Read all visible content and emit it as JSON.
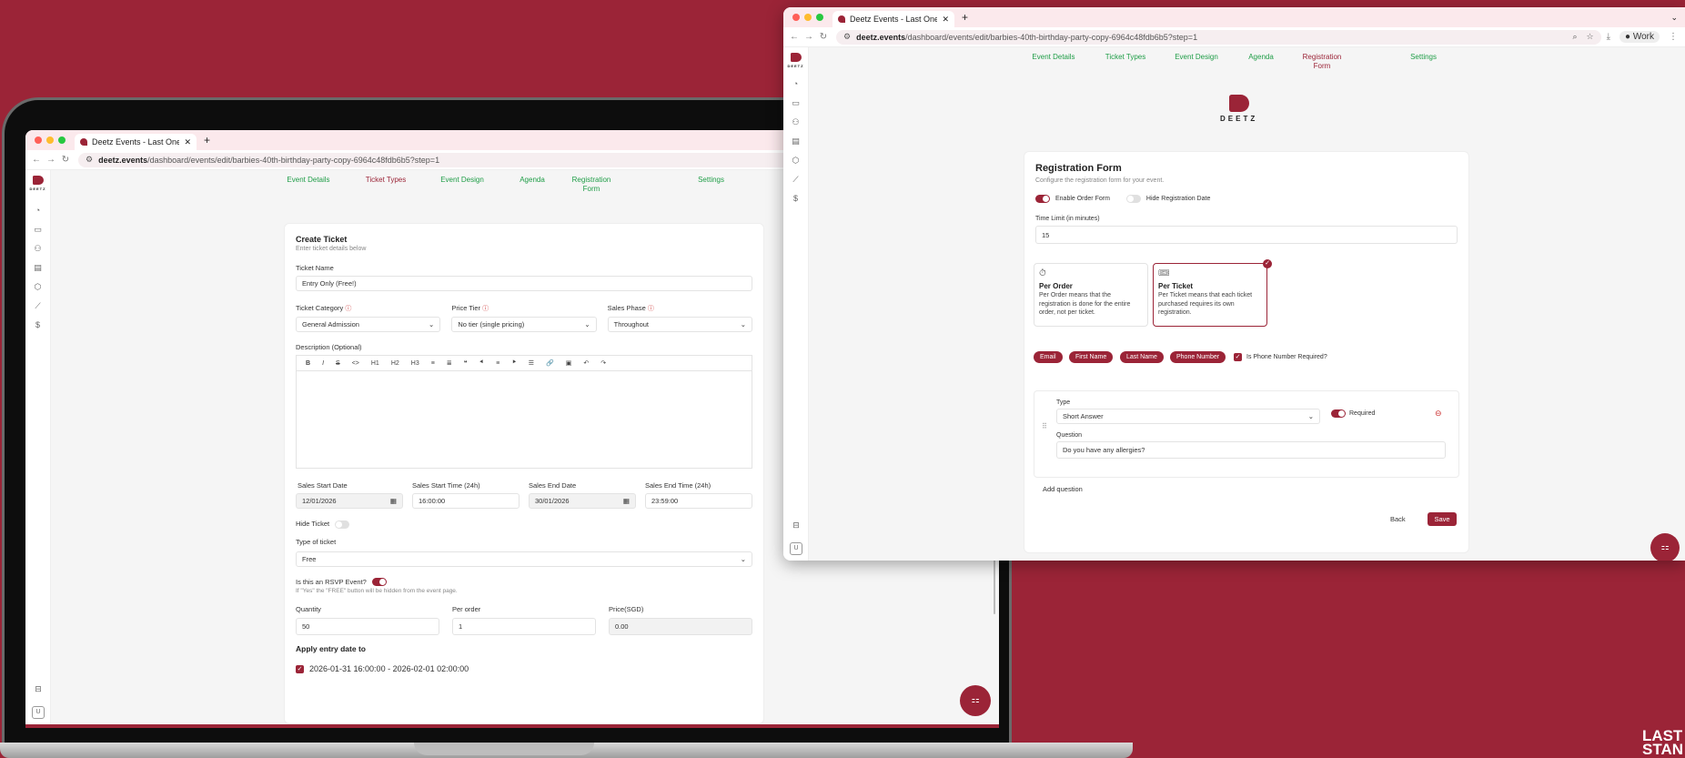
{
  "browser": {
    "tab_title": "Deetz Events - Last One Stan",
    "url_domain": "deetz.events",
    "url_path": "/dashboard/events/edit/barbies-40th-birthday-party-copy-6964c48fdb6b5?step=1",
    "profile": "Work"
  },
  "brand": {
    "logo_text": "DEETZ",
    "corner_text_1": "LAST",
    "corner_text_2": "STAN"
  },
  "steps": [
    {
      "label": "Event Details"
    },
    {
      "label": "Ticket Types"
    },
    {
      "label": "Event Design"
    },
    {
      "label": "Agenda"
    },
    {
      "label": "Registration Form"
    },
    {
      "label": "Settings"
    }
  ],
  "sidebar": {
    "avatar_initial": "U"
  },
  "create_ticket": {
    "title": "Create Ticket",
    "subtitle": "Enter ticket details below",
    "ticket_name_label": "Ticket Name",
    "ticket_name_value": "Entry Only (Free!)",
    "category_label": "Ticket Category",
    "category_value": "General Admission",
    "price_tier_label": "Price Tier",
    "price_tier_value": "No tier (single pricing)",
    "sales_phase_label": "Sales Phase",
    "sales_phase_value": "Throughout",
    "description_label": "Description (Optional)",
    "toolbar": [
      "B",
      "I",
      "S",
      "<>",
      "H1",
      "H2",
      "H3",
      "≡",
      "≣",
      "❝",
      "⯇",
      "≡",
      "⯈",
      "☰",
      "🔗",
      "▣",
      "↶",
      "↷"
    ],
    "sales_start_date_label": "Sales Start Date",
    "sales_start_date_value": "12/01/2026",
    "sales_start_time_label": "Sales Start Time (24h)",
    "sales_start_time_value": "16:00:00",
    "sales_end_date_label": "Sales End Date",
    "sales_end_date_value": "30/01/2026",
    "sales_end_time_label": "Sales End Time (24h)",
    "sales_end_time_value": "23:59:00",
    "hide_ticket_label": "Hide Ticket",
    "type_label": "Type of ticket",
    "type_value": "Free",
    "rsvp_label": "Is this an RSVP Event?",
    "rsvp_hint": "If \"Yes\" the \"FREE\" button will be hidden from the event page.",
    "quantity_label": "Quantity",
    "quantity_value": "50",
    "per_order_label": "Per order",
    "per_order_value": "1",
    "price_label": "Price(SGD)",
    "price_value": "0.00",
    "apply_label": "Apply entry date to",
    "apply_item": "2026-01-31 16:00:00 - 2026-02-01 02:00:00"
  },
  "registration": {
    "title": "Registration Form",
    "subtitle": "Configure the registration form for your event.",
    "enable_order_form": "Enable Order Form",
    "hide_registration_date": "Hide Registration Date",
    "time_limit_label": "Time Limit (in minutes)",
    "time_limit_value": "15",
    "per_order_title": "Per Order",
    "per_order_desc": "Per Order means that the registration is done for the entire order, not per ticket.",
    "per_ticket_title": "Per Ticket",
    "per_ticket_desc": "Per Ticket means that each ticket purchased requires its own registration.",
    "fields": [
      "Email",
      "First Name",
      "Last Name",
      "Phone Number"
    ],
    "phone_required": "Is Phone Number Required?",
    "type_label": "Type",
    "type_value": "Short Answer",
    "required_label": "Required",
    "question_label": "Question",
    "question_value": "Do you have any allergies?",
    "add_question": "Add question",
    "back": "Back",
    "save": "Save"
  },
  "colors": {
    "accent": "#9b2437",
    "step_green": "#1f9d47"
  }
}
